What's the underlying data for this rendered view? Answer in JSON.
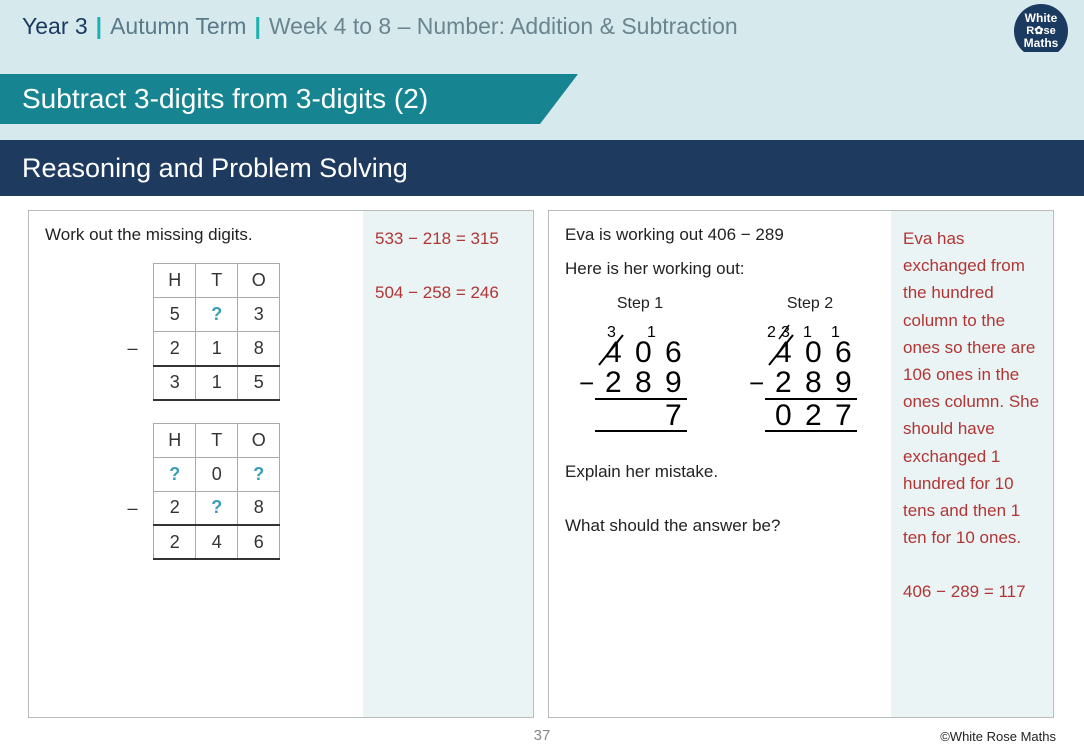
{
  "header": {
    "year": "Year 3",
    "term": "Autumn Term",
    "week": "Week 4 to 8 – Number: Addition & Subtraction",
    "logo_l1": "White",
    "logo_l2": "R✿se",
    "logo_l3": "Maths"
  },
  "title": "Subtract 3-digits from 3-digits (2)",
  "subtitle": "Reasoning and Problem Solving",
  "left": {
    "prompt": "Work out the missing digits.",
    "table1": {
      "headers": [
        "H",
        "T",
        "O"
      ],
      "r1": [
        "5",
        "?",
        "3"
      ],
      "r2_sign": "–",
      "r2": [
        "2",
        "1",
        "8"
      ],
      "r3": [
        "3",
        "1",
        "5"
      ]
    },
    "table2": {
      "headers": [
        "H",
        "T",
        "O"
      ],
      "r1": [
        "?",
        "0",
        "?"
      ],
      "r2_sign": "–",
      "r2": [
        "2",
        "?",
        "8"
      ],
      "r3": [
        "2",
        "4",
        "6"
      ]
    },
    "answer1": "533 − 218 = 315",
    "answer2": "504 − 258 = 246"
  },
  "right": {
    "line1": "Eva is working out 406 − 289",
    "line2": "Here is her working out:",
    "step1_label": "Step 1",
    "step2_label": "Step 2",
    "step1": {
      "top_super": [
        "3",
        "",
        "1",
        ""
      ],
      "top": [
        "4",
        "0",
        "6"
      ],
      "top_strike": [
        true,
        false,
        false
      ],
      "sub": [
        "2",
        "8",
        "9"
      ],
      "res": [
        "",
        "",
        "7"
      ]
    },
    "step2": {
      "top_super": [
        "2",
        "3",
        "1",
        "1"
      ],
      "top": [
        "4",
        "0",
        "6"
      ],
      "top_strike": [
        true,
        false,
        false
      ],
      "super_strike": [
        false,
        true,
        false,
        false
      ],
      "sub": [
        "2",
        "8",
        "9"
      ],
      "res": [
        "0",
        "2",
        "7"
      ]
    },
    "line3": "Explain her mistake.",
    "line4": "What should the answer be?",
    "answer_text": "Eva has exchanged from the hundred column to the ones so there are 106 ones in the ones column. She should have exchanged 1 hundred for 10 tens and then 1 ten for 10 ones.",
    "answer_calc": "406 − 289 = 117"
  },
  "page_num": "37",
  "copyright": "©White Rose Maths"
}
